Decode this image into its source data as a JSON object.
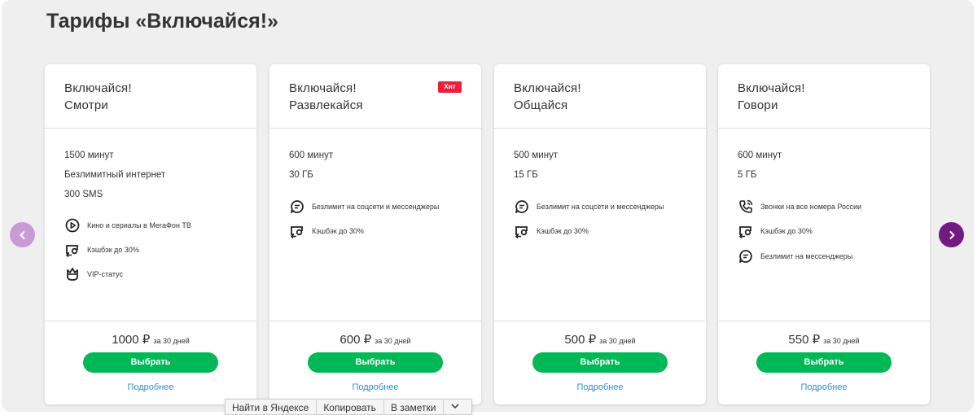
{
  "page": {
    "title": "Тарифы «Включайся!»"
  },
  "colors": {
    "accent_green": "#00b956",
    "brand_purple": "#731982",
    "hit_red": "#ee1f3a",
    "link_blue": "#2f8fd4"
  },
  "cards": [
    {
      "name_line1": "Включайся!",
      "name_line2": "Смотри",
      "features": [
        "1500 минут",
        "Безлимитный интернет",
        "300 SMS"
      ],
      "options": [
        {
          "icon": "play-circle-icon",
          "text": "Кино и сериалы в МегаФон ТВ"
        },
        {
          "icon": "cashback-icon",
          "text": "Кэшбэк до 30%"
        },
        {
          "icon": "crown-icon",
          "text": "VIP-статус"
        }
      ],
      "price": "1000 ₽",
      "period": "за 30 дней",
      "button": "Выбрать",
      "more": "Подробнее"
    },
    {
      "name_line1": "Включайся!",
      "name_line2": "Развлекайся",
      "badge": "Хит",
      "features": [
        "600 минут",
        "30 ГБ"
      ],
      "options": [
        {
          "icon": "chat-bubble-icon",
          "text": "Безлимит на соцсети и мессенджеры"
        },
        {
          "icon": "cashback-icon",
          "text": "Кэшбэк до 30%"
        }
      ],
      "price": "600 ₽",
      "period": "за 30 дней",
      "button": "Выбрать",
      "more": "Подробнее"
    },
    {
      "name_line1": "Включайся!",
      "name_line2": "Общайся",
      "features": [
        "500 минут",
        "15 ГБ"
      ],
      "options": [
        {
          "icon": "chat-bubble-icon",
          "text": "Безлимит на соцсети и мессенджеры"
        },
        {
          "icon": "cashback-icon",
          "text": "Кэшбэк до 30%"
        }
      ],
      "price": "500 ₽",
      "period": "за 30 дней",
      "button": "Выбрать",
      "more": "Подробнее"
    },
    {
      "name_line1": "Включайся!",
      "name_line2": "Говори",
      "features": [
        "600 минут",
        "5 ГБ"
      ],
      "options": [
        {
          "icon": "phone-calling-icon",
          "text": "Звонки на все номера России"
        },
        {
          "icon": "cashback-icon",
          "text": "Кэшбэк до 30%"
        },
        {
          "icon": "chat-bubble-icon",
          "text": "Безлимит на мессенджеры"
        }
      ],
      "price": "550 ₽",
      "period": "за 30 дней",
      "button": "Выбрать",
      "more": "Подробнее"
    }
  ],
  "context_menu": {
    "items": [
      "Найти в Яндексе",
      "Копировать",
      "В заметки"
    ]
  }
}
